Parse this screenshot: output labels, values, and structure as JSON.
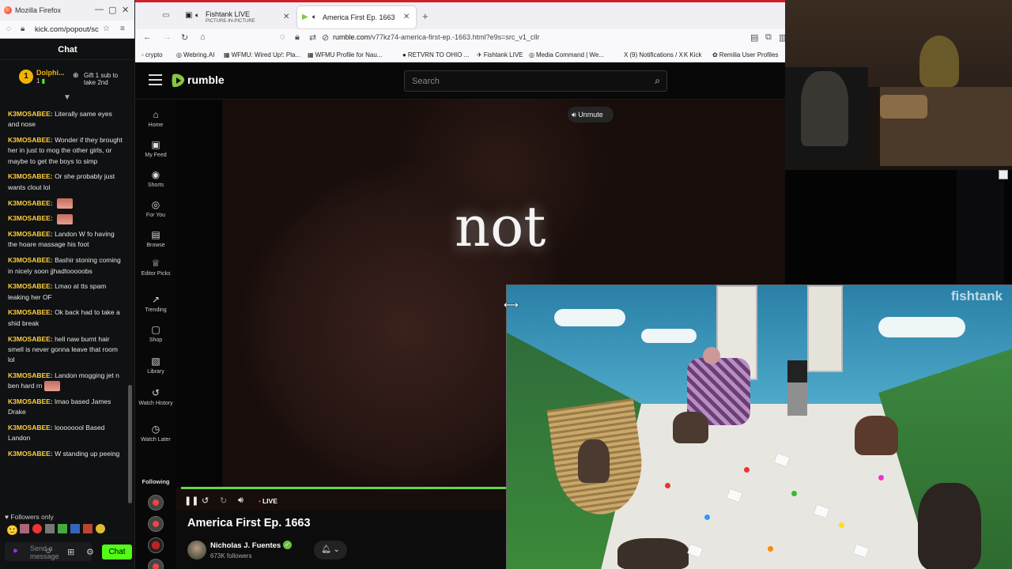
{
  "kick_window": {
    "title": "Mozilla Firefox",
    "url": "kick.com/popout/sc",
    "chat_header": "Chat",
    "pinned": {
      "rank": "1",
      "name": "Dolphi...",
      "count": "1",
      "gift_text": "Gift 1 sub to take 2nd"
    },
    "messages": [
      {
        "user": "K3MOSABEE:",
        "text": "Literally same eyes and nose"
      },
      {
        "user": "K3MOSABEE:",
        "text": "Wonder if they brought her in just to mog the other girls, or maybe to get the boys to simp"
      },
      {
        "user": "K3MOSABEE:",
        "text": "Or she probably just wants clout lol"
      },
      {
        "user": "K3MOSABEE:",
        "text": "",
        "emote": true
      },
      {
        "user": "K3MOSABEE:",
        "text": "",
        "emote": true
      },
      {
        "user": "K3MOSABEE:",
        "text": "Landon W fo having the hoare massage his foot"
      },
      {
        "user": "K3MOSABEE:",
        "text": "Bashir stoning coming in nicely soon jjhadtooooobs"
      },
      {
        "user": "K3MOSABEE:",
        "text": "Lmao at tts spam leaking her OF"
      },
      {
        "user": "K3MOSABEE:",
        "text": "Ok back had to take a shid break"
      },
      {
        "user": "K3MOSABEE:",
        "text": "hell naw burnt hair smell is never gonna leave that room lol"
      },
      {
        "user": "K3MOSABEE:",
        "text": "Landon mogging jet n ben hard rn",
        "emote": true
      },
      {
        "user": "K3MOSABEE:",
        "text": "lmao based James Drake"
      },
      {
        "user": "K3MOSABEE:",
        "text": "loooooool Based Landon"
      },
      {
        "user": "K3MOSABEE:",
        "text": "W standing up peeing"
      }
    ],
    "followers_only": "Followers only",
    "input_placeholder": "Send a message",
    "send_label": "Chat"
  },
  "browser": {
    "tabs": [
      {
        "label": "Fishtank LIVE",
        "sub": "PICTURE-IN-PICTURE"
      },
      {
        "label": "America First Ep. 1663",
        "sub": ""
      }
    ],
    "url_host": "rumble.com",
    "url_path": "/v77kz74-america-first-ep.-1663.html?e9s=src_v1_cllr",
    "bookmarks": [
      {
        "icon": "◦",
        "label": "crypto"
      },
      {
        "icon": "◎",
        "label": "Webring.AI"
      },
      {
        "icon": "▦",
        "label": "WFMU: Wired Up!: Pla..."
      },
      {
        "icon": "▦",
        "label": "WFMU Profile for Nau..."
      },
      {
        "icon": "●",
        "label": "RETVRN TO OHIO ..."
      },
      {
        "icon": "✈",
        "label": "Fishtank LIVE"
      },
      {
        "icon": "◎",
        "label": "Media Command | We..."
      },
      {
        "icon": "X",
        "label": "(9) Notifications / X"
      },
      {
        "icon": "K",
        "label": "Kick"
      },
      {
        "icon": "✿",
        "label": "Remilia User Profiles"
      }
    ]
  },
  "rumble": {
    "logo": "rumble",
    "search_placeholder": "Search",
    "nav": [
      {
        "icon": "⌂",
        "label": "Home"
      },
      {
        "icon": "▣",
        "label": "My Feed"
      },
      {
        "icon": "◉",
        "label": "Shorts"
      },
      {
        "icon": "◎",
        "label": "For You"
      },
      {
        "icon": "▤",
        "label": "Browse"
      },
      {
        "icon": "♕",
        "label": "Editor Picks"
      },
      {
        "icon": "↗",
        "label": "Trending"
      },
      {
        "icon": "▢",
        "label": "Shop"
      },
      {
        "icon": "▧",
        "label": "Library"
      },
      {
        "icon": "↺",
        "label": "Watch History"
      },
      {
        "icon": "◷",
        "label": "Watch Later"
      }
    ],
    "following_label": "Following",
    "caption": "not",
    "unmute_label": "Unmute",
    "live_label": "LIVE",
    "video_title": "America First Ep. 1663",
    "channel_name": "Nicholas J. Fuentes",
    "followers": "673K followers"
  },
  "pip": {
    "watermark": "fishtank"
  },
  "colors": {
    "kick_green": "#53fc18",
    "rumble_green": "#85c742",
    "chat_username": "#ffcf3e"
  }
}
